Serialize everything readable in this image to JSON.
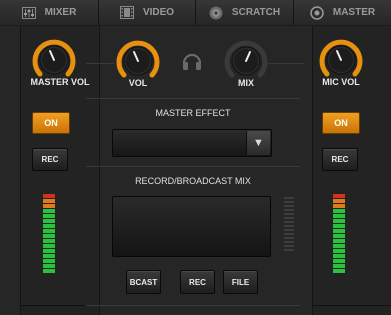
{
  "tabs": [
    {
      "label": "MIXER",
      "icon": "mixer-icon"
    },
    {
      "label": "VIDEO",
      "icon": "film-icon"
    },
    {
      "label": "SCRATCH",
      "icon": "vinyl-icon"
    },
    {
      "label": "MASTER",
      "icon": "master-icon"
    }
  ],
  "left_rail": {
    "knob_label": "MASTER VOL",
    "on_label": "ON",
    "rec_label": "REC"
  },
  "right_rail": {
    "knob_label": "MIC VOL",
    "on_label": "ON",
    "rec_label": "REC"
  },
  "center": {
    "vol_label": "VOL",
    "mix_label": "MIX",
    "headphones_icon": "headphones-icon",
    "master_effect_title": "MASTER EFFECT",
    "master_effect_value": "",
    "record_title": "RECORD/BROADCAST MIX",
    "bcast_label": "BCAST",
    "rec_label": "REC",
    "file_label": "FILE"
  },
  "colors": {
    "accent": "#e8900f",
    "meter_green": "#29c23c",
    "meter_red": "#d4321f",
    "meter_orange": "#e07a1a"
  },
  "meters": {
    "segments": [
      "red",
      "orange",
      "orange",
      "green",
      "green",
      "green",
      "green",
      "green",
      "green",
      "green",
      "green",
      "green",
      "green",
      "green",
      "green",
      "green"
    ]
  }
}
